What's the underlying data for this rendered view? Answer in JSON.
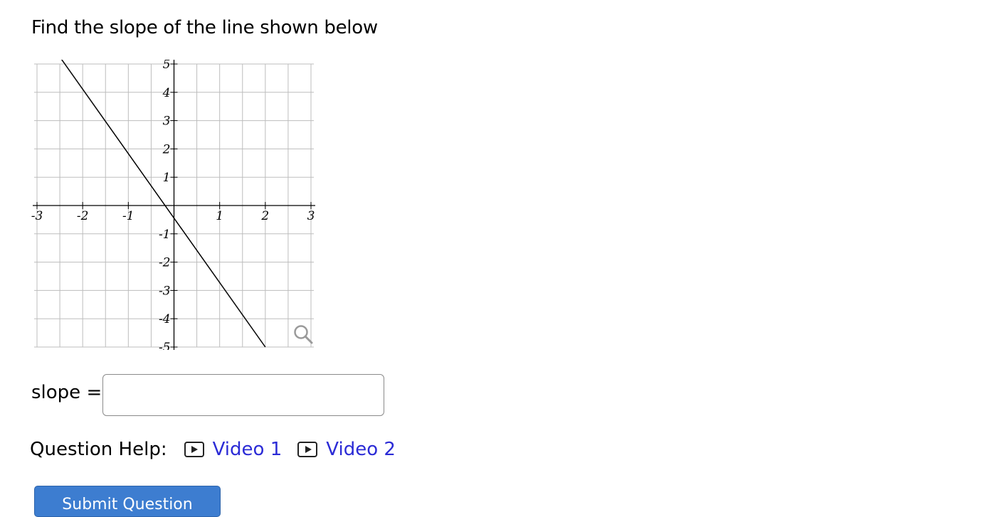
{
  "question": {
    "text": "Find the slope of the line shown below"
  },
  "chart_data": {
    "type": "line",
    "xlim": [
      -3,
      3
    ],
    "ylim": [
      -5,
      5
    ],
    "grid": true,
    "x_ticks": [
      "-3",
      "-2",
      "-1",
      "1",
      "2",
      "3"
    ],
    "y_ticks": [
      "5",
      "4",
      "3",
      "2",
      "1",
      "-1",
      "-2",
      "-3",
      "-4",
      "-5"
    ],
    "series": [
      {
        "x": [
          -2.5,
          2
        ],
        "y": [
          5.25,
          -5
        ],
        "color": "#000000"
      }
    ]
  },
  "zoom_icon": "magnifier-icon",
  "answer": {
    "label": "slope =",
    "value": "",
    "placeholder": ""
  },
  "help": {
    "label": "Question Help:",
    "links": [
      {
        "label": "Video 1",
        "icon": "play-icon"
      },
      {
        "label": "Video 2",
        "icon": "play-icon"
      }
    ]
  },
  "submit": {
    "label": "Submit Question"
  },
  "colors": {
    "link": "#2b2bd6",
    "submit_bg": "#3d7dd0",
    "grid": "#bdbdbd"
  }
}
